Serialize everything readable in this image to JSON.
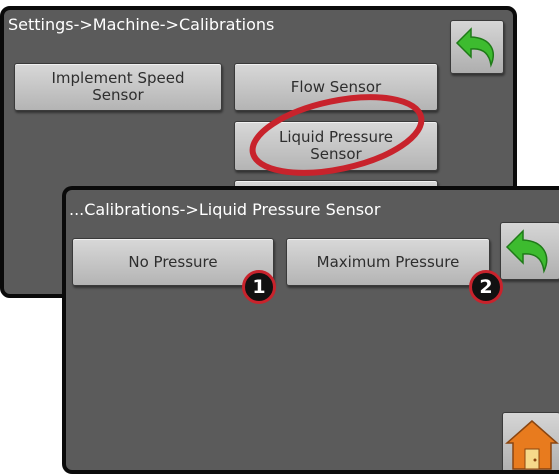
{
  "back_screen": {
    "breadcrumb": "Settings->Machine->Calibrations",
    "buttons": {
      "implement_speed_sensor": "Implement Speed\nSensor",
      "flow_sensor": "Flow Sensor",
      "liquid_pressure_sensor": "Liquid Pressure\nSensor"
    },
    "back_icon": "undo-arrow-icon"
  },
  "front_screen": {
    "breadcrumb": "...Calibrations->Liquid Pressure Sensor",
    "buttons": {
      "no_pressure": "No Pressure",
      "maximum_pressure": "Maximum Pressure"
    },
    "back_icon": "undo-arrow-icon",
    "home_icon": "home-icon"
  },
  "callouts": {
    "marker_1": "1",
    "marker_2": "2"
  },
  "colors": {
    "screen_bg": "#5b5b5b",
    "accent_green": "#3dbb2f",
    "highlight_red": "#c8232c",
    "home_orange": "#e87b1e"
  }
}
